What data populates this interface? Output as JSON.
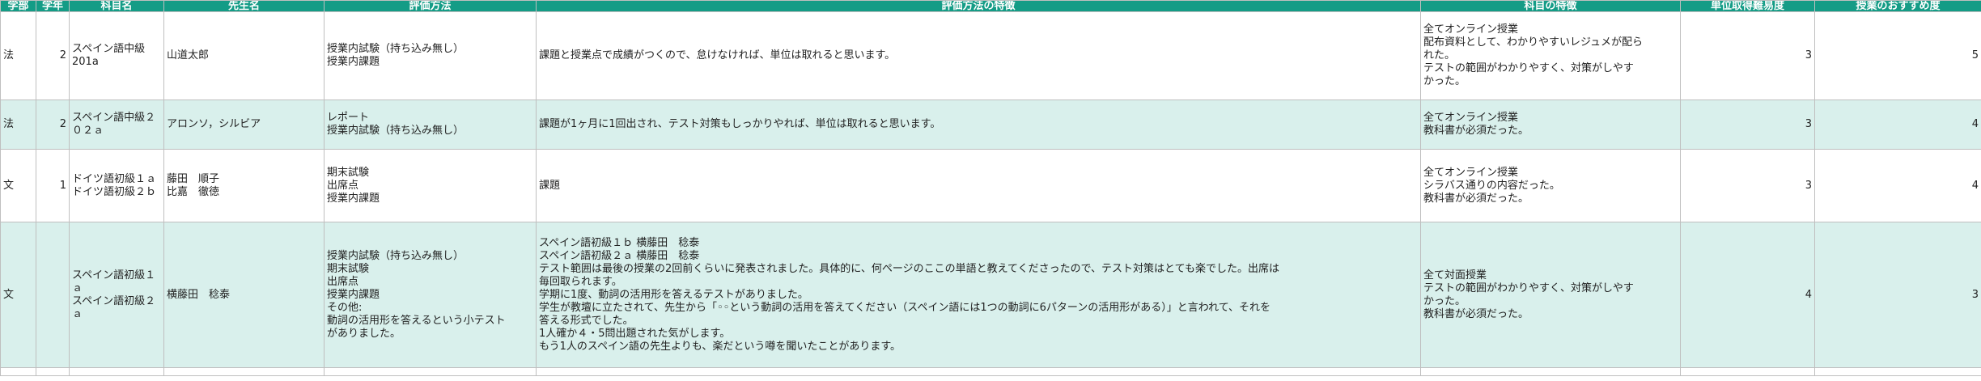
{
  "headers": [
    "学部",
    "学年",
    "科目名",
    "先生名",
    "評価方法",
    "評価方法の特徴",
    "科目の特徴",
    "単位取得難易度",
    "授業のおすすめ度"
  ],
  "rows": [
    {
      "faculty": "法",
      "year": "2",
      "subject": [
        "スペイン語中級201a"
      ],
      "teacher": [
        "山道太郎"
      ],
      "method": [
        "授業内試験（持ち込み無し）",
        "授業内課題"
      ],
      "method_feature": [
        "課題と授業点で成績がつくので、怠けなければ、単位は取れると思います。"
      ],
      "course_feature": [
        "全てオンライン授業",
        "配布資料として、わかりやすいレジュメが配ら",
        "れた。",
        "テストの範囲がわかりやすく、対策がしやす",
        "かった。"
      ],
      "difficulty": "3",
      "recommend": "5"
    },
    {
      "faculty": "法",
      "year": "2",
      "subject": [
        "スペイン語中級２０２ａ"
      ],
      "teacher": [
        "アロンソ，シルビア"
      ],
      "method": [
        "レポート",
        "授業内試験（持ち込み無し）"
      ],
      "method_feature": [
        "課題が1ヶ月に1回出され、テスト対策もしっかりやれば、単位は取れると思います。"
      ],
      "course_feature": [
        "全てオンライン授業",
        "教科書が必須だった。"
      ],
      "difficulty": "3",
      "recommend": "4"
    },
    {
      "faculty": "文",
      "year": "1",
      "subject": [
        "ドイツ語初級１ａ",
        "ドイツ語初級２ｂ"
      ],
      "teacher": [
        "藤田　順子",
        "比嘉　徹徳"
      ],
      "method": [
        "期末試験",
        "出席点",
        "授業内課題"
      ],
      "method_feature": [
        "課題"
      ],
      "course_feature": [
        "全てオンライン授業",
        "シラバス通りの内容だった。",
        "教科書が必須だった。"
      ],
      "difficulty": "3",
      "recommend": "4"
    },
    {
      "faculty": "文",
      "year": "",
      "subject": [
        "スペイン語初級１ａ",
        "スペイン語初級２ａ"
      ],
      "teacher": [
        "横藤田　稔泰"
      ],
      "method": [
        "授業内試験（持ち込み無し）",
        "期末試験",
        "出席点",
        "授業内課題",
        "その他:",
        "動詞の活用形を答えるという小テスト",
        "がありました。"
      ],
      "method_feature": [
        "スペイン語初級１ｂ 横藤田　稔泰",
        "スペイン語初級２ａ 横藤田　稔泰",
        "テスト範囲は最後の授業の2回前くらいに発表されました。具体的に、何ページのここの単語と教えてくださったので、テスト対策はとても楽でした。出席は",
        "毎回取られます。",
        "学期に1度、動詞の活用形を答えるテストがありました。",
        "学生が教壇に立たされて、先生から「◦◦という動詞の活用を答えてください（スペイン語には1つの動詞に6パターンの活用形がある）」と言われて、それを",
        "答える形式でした。",
        "1人確か４・5問出題された気がします。",
        "もう1人のスペイン語の先生よりも、楽だという噂を聞いたことがあります。"
      ],
      "course_feature": [
        "全て対面授業",
        "テストの範囲がわかりやすく、対策がしやす",
        "かった。",
        "教科書が必須だった。"
      ],
      "difficulty": "4",
      "recommend": "3"
    }
  ]
}
